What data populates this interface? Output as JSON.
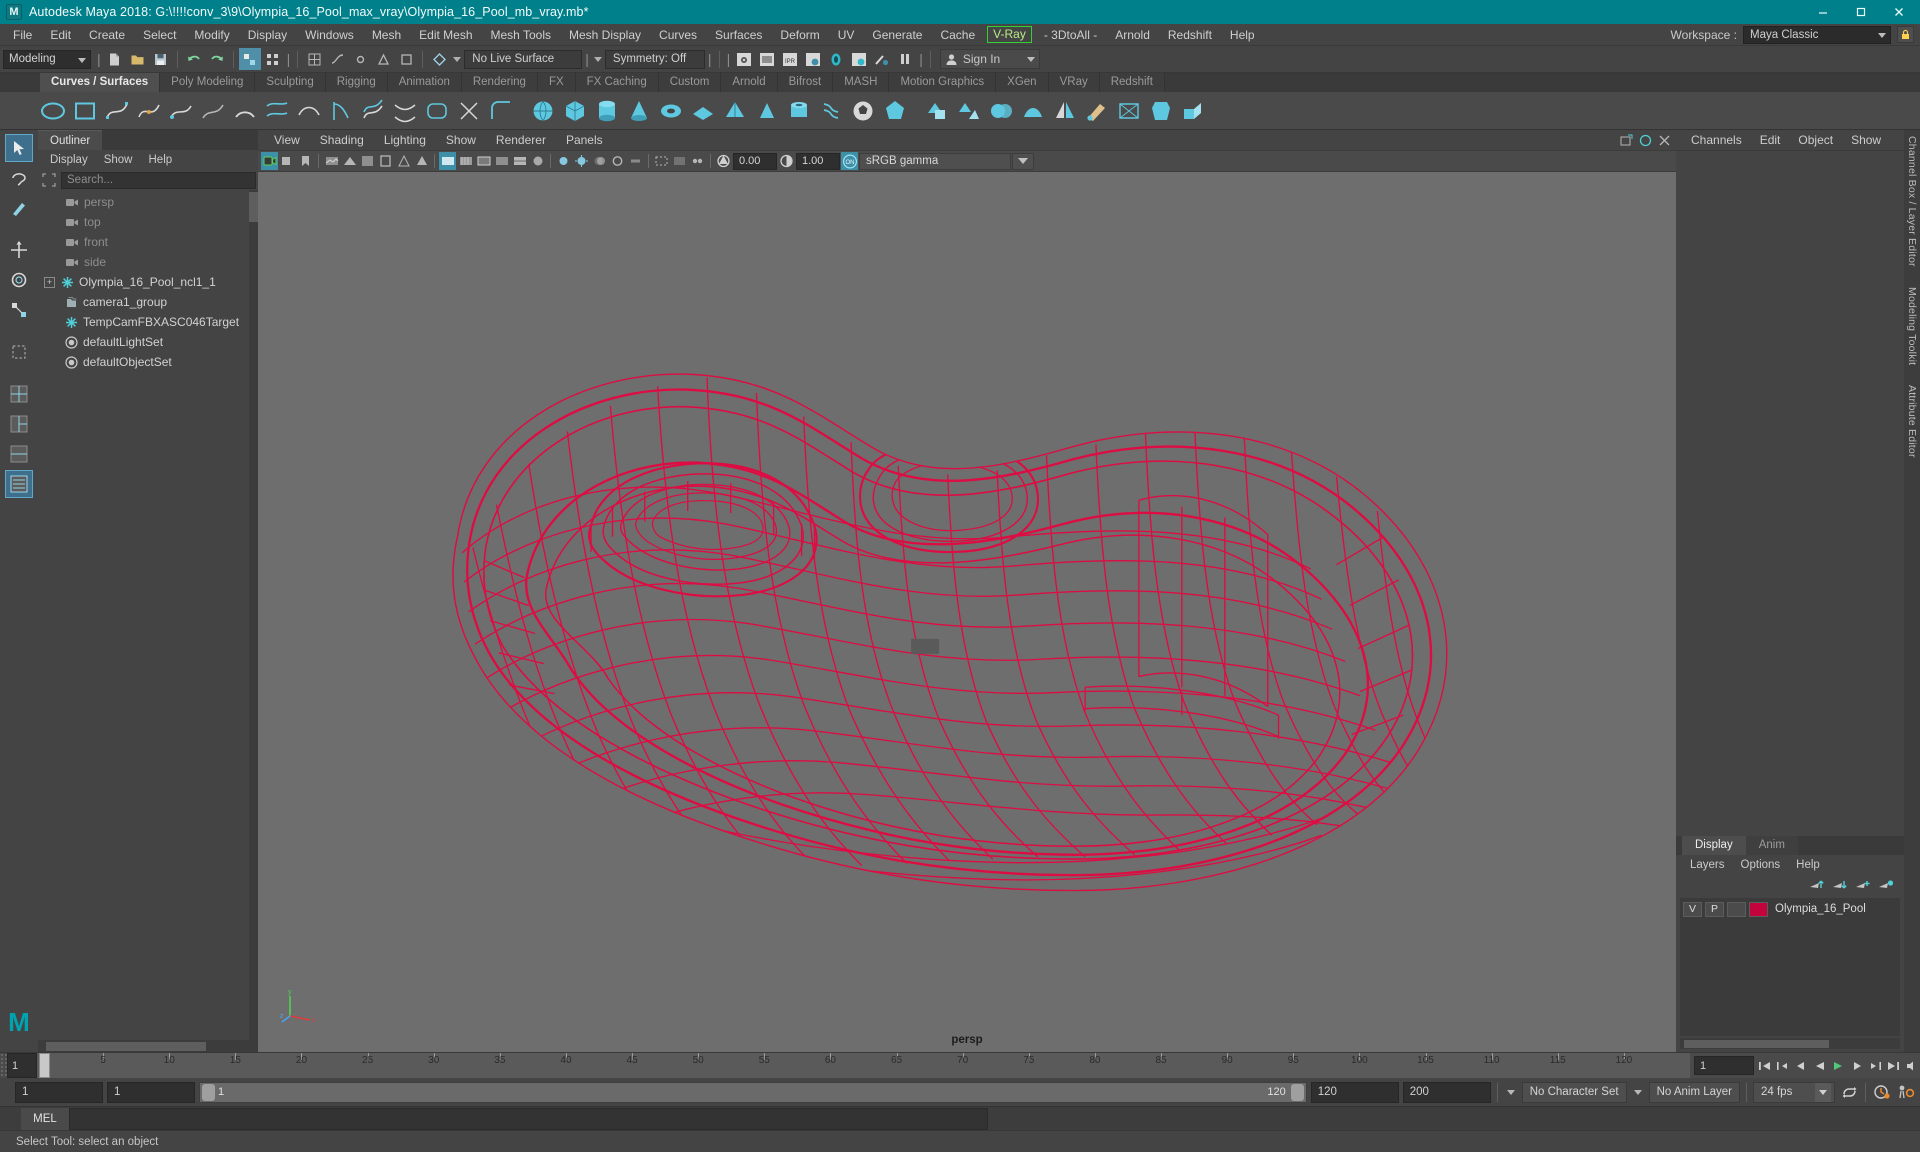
{
  "titlebar": {
    "app_title": "Autodesk Maya 2018: G:\\!!!!conv_3\\9\\Olympia_16_Pool_max_vray\\Olympia_16_Pool_mb_vray.mb*",
    "logo": "M",
    "minimize": "—",
    "maximize": "▢",
    "close": "✕"
  },
  "menubar": {
    "items": [
      "File",
      "Edit",
      "Create",
      "Select",
      "Modify",
      "Display",
      "Windows",
      "Mesh",
      "Edit Mesh",
      "Mesh Tools",
      "Mesh Display",
      "Curves",
      "Surfaces",
      "Deform",
      "UV",
      "Generate",
      "Cache"
    ],
    "vray_item": "V-Ray",
    "plugin_items": [
      "- 3DtoAll -",
      "Arnold",
      "Redshift",
      "Help"
    ],
    "workspace_label": "Workspace :",
    "workspace_value": "Maya Classic"
  },
  "toolbar": {
    "mode": "Modeling",
    "live_surface": "No Live Surface",
    "symmetry": "Symmetry: Off",
    "signin": "Sign In"
  },
  "shelf": {
    "tabs": [
      "Curves / Surfaces",
      "Poly Modeling",
      "Sculpting",
      "Rigging",
      "Animation",
      "Rendering",
      "FX",
      "FX Caching",
      "Custom",
      "Arnold",
      "Bifrost",
      "MASH",
      "Motion Graphics",
      "XGen",
      "VRay",
      "Redshift"
    ],
    "active_tab": "Curves / Surfaces"
  },
  "outliner": {
    "tab": "Outliner",
    "menus": [
      "Display",
      "Show",
      "Help"
    ],
    "search_placeholder": "Search...",
    "items": [
      {
        "label": "persp",
        "icon": "camera-icon",
        "dim": true,
        "expand": false,
        "indent": true
      },
      {
        "label": "top",
        "icon": "camera-icon",
        "dim": true,
        "expand": false,
        "indent": true
      },
      {
        "label": "front",
        "icon": "camera-icon",
        "dim": true,
        "expand": false,
        "indent": true
      },
      {
        "label": "side",
        "icon": "camera-icon",
        "dim": true,
        "expand": false,
        "indent": true
      },
      {
        "label": "Olympia_16_Pool_ncl1_1",
        "icon": "transform-icon",
        "dim": false,
        "expand": true,
        "indent": false
      },
      {
        "label": "camera1_group",
        "icon": "group-icon",
        "dim": false,
        "expand": false,
        "indent": true
      },
      {
        "label": "TempCamFBXASC046Target",
        "icon": "transform-icon",
        "dim": false,
        "expand": false,
        "indent": true
      },
      {
        "label": "defaultLightSet",
        "icon": "set-icon",
        "dim": false,
        "expand": false,
        "indent": true
      },
      {
        "label": "defaultObjectSet",
        "icon": "set-icon",
        "dim": false,
        "expand": false,
        "indent": true
      }
    ]
  },
  "viewport": {
    "menus": [
      "View",
      "Shading",
      "Lighting",
      "Show",
      "Renderer",
      "Panels"
    ],
    "exposure": "0.00",
    "gamma": "1.00",
    "colorspace": "sRGB gamma",
    "camera_label": "persp",
    "axis": {
      "x": "x",
      "y": "y",
      "z": "z"
    }
  },
  "channelbox": {
    "tabs": [
      "Channels",
      "Edit",
      "Object",
      "Show"
    ]
  },
  "layers": {
    "tabs": [
      "Display",
      "Anim"
    ],
    "active_tab": "Display",
    "menus": [
      "Layers",
      "Options",
      "Help"
    ],
    "rows": [
      {
        "visible": "V",
        "playback": "P",
        "state": "",
        "color": "#c2033c",
        "name": "Olympia_16_Pool"
      }
    ]
  },
  "vtabs": [
    "Channel Box / Layer Editor",
    "Modeling Toolkit",
    "Attribute Editor"
  ],
  "timeline": {
    "current_frame": "1",
    "ticks": [
      "5",
      "10",
      "15",
      "20",
      "25",
      "30",
      "35",
      "40",
      "45",
      "50",
      "55",
      "60",
      "65",
      "70",
      "75",
      "80",
      "85",
      "90",
      "95",
      "100",
      "105",
      "110",
      "115",
      "120"
    ],
    "playback_field": "1"
  },
  "range": {
    "start": "1",
    "start2": "1",
    "slider_min": "1",
    "slider_max": "120",
    "end": "120",
    "end2": "200",
    "character_set": "No Character Set",
    "anim_layer": "No Anim Layer",
    "fps": "24 fps"
  },
  "command": {
    "tab": "MEL",
    "input": ""
  },
  "statusbar": {
    "text": "Select Tool: select an object"
  },
  "colors": {
    "title_bg": "#00808a",
    "panel_bg": "#444444",
    "viewport_bg": "#6e6e6e",
    "wireframe": "#dd0d43",
    "accent": "#3e8fa8",
    "vray_green": "#34d034"
  }
}
